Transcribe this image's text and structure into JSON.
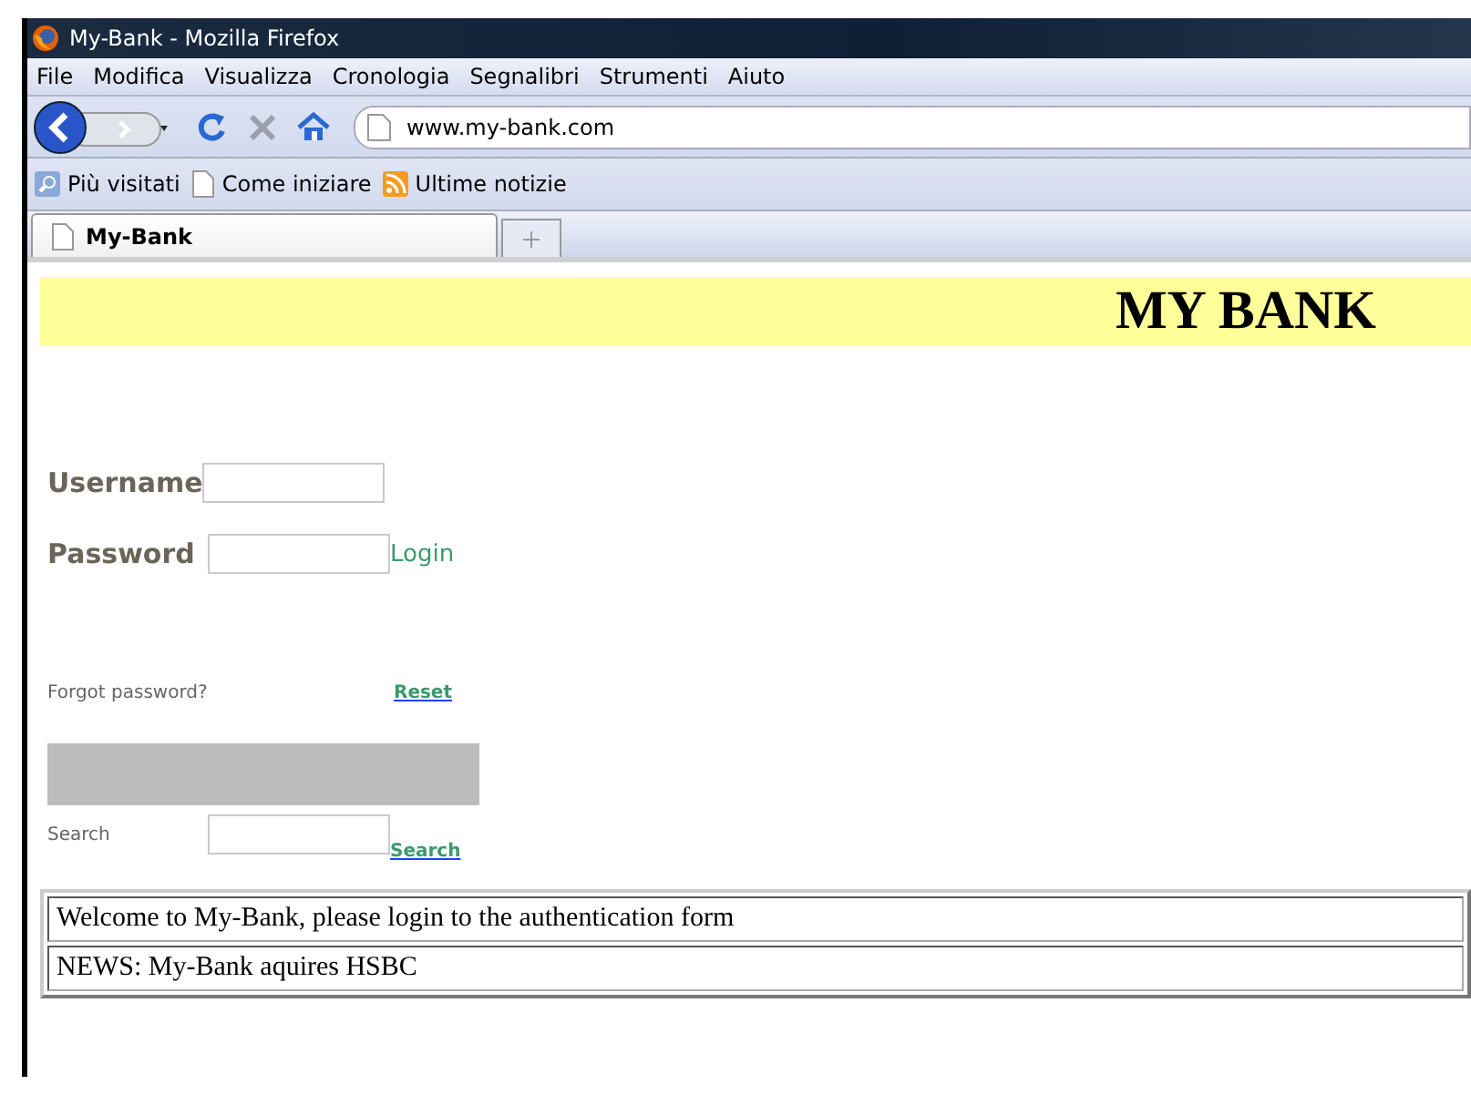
{
  "window": {
    "title": "My-Bank - Mozilla Firefox"
  },
  "menu": [
    "File",
    "Modifica",
    "Visualizza",
    "Cronologia",
    "Segnalibri",
    "Strumenti",
    "Aiuto"
  ],
  "address": "www.my-bank.com",
  "bookmarks": [
    {
      "label": "Più visitati",
      "kind": "search"
    },
    {
      "label": "Come iniziare",
      "kind": "page"
    },
    {
      "label": "Ultime notizie",
      "kind": "feed"
    }
  ],
  "tabs": [
    {
      "label": "My-Bank",
      "selected": true
    }
  ],
  "page": {
    "banner": "MY BANK",
    "username_label": "Username",
    "password_label": "Password",
    "login_link": "Login",
    "forgot_text": "Forgot password?",
    "reset_link": "Reset",
    "search_label": "Search",
    "search_link": "Search",
    "messages": [
      "Welcome to My-Bank, please login to the authentication form",
      "NEWS: My-Bank aquires HSBC"
    ]
  }
}
